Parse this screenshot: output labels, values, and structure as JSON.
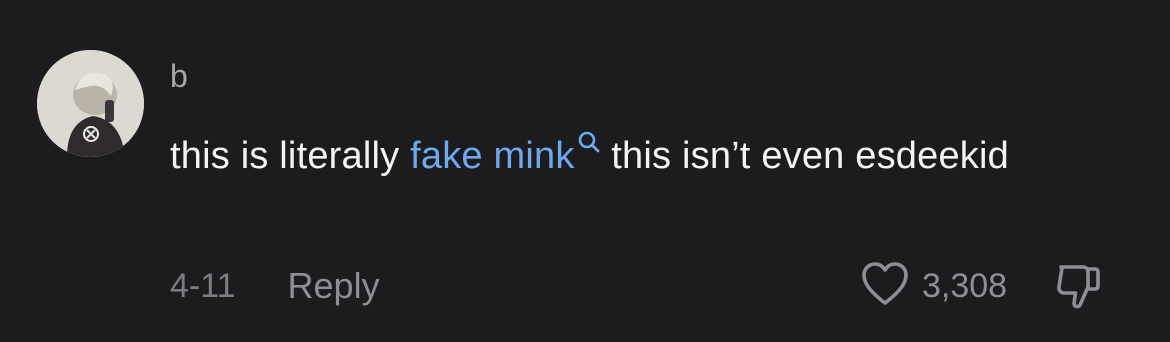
{
  "comment": {
    "username": "b",
    "text_before": "this is literally ",
    "link_text": "fake mink",
    "text_after": " this isn’t even esdeekid",
    "date": "4-11",
    "reply_label": "Reply",
    "like_count": "3,308"
  },
  "icons": {
    "search": "search-icon",
    "like": "heart-icon",
    "dislike": "thumbs-down-icon"
  },
  "colors": {
    "background": "#1c1c1e",
    "link": "#6ea8ef",
    "muted": "#8e8e93"
  }
}
